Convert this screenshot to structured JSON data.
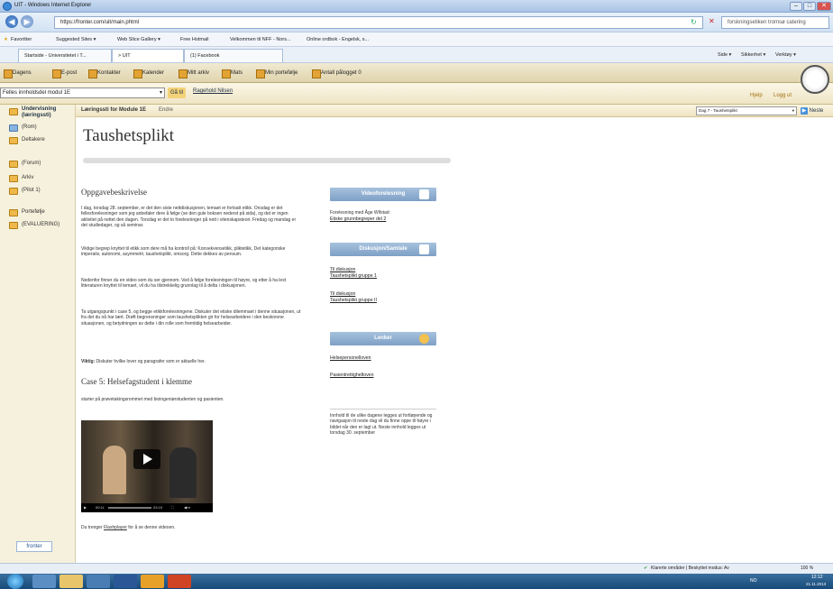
{
  "window": {
    "title": "UIT - Windows Internet Explorer"
  },
  "address": {
    "url": "https://fronter.com/uit/main.phtml",
    "search_placeholder": "forskningsetiken tromsø catering"
  },
  "favorites": {
    "label": "Favoritter",
    "items": [
      "Suggested Sites ▾",
      "Web Slice Gallery ▾",
      "Free Hotmail",
      "Velkommen til NFF - Nors...",
      "Online ordbok - Engelsk, s..."
    ]
  },
  "tabs": [
    {
      "label": "Startside - Universitetet i T..."
    },
    {
      "label": "> UIT"
    },
    {
      "label": "(1) Facebook"
    }
  ],
  "ie_commands": {
    "side": "Side ▾",
    "sikkerhet": "Sikkerhet ▾",
    "verktoy": "Verktøy ▾"
  },
  "lms_nav": [
    "Dagens",
    "E-post",
    "Kontakter",
    "Kalender",
    "Mitt arkiv",
    "Mats",
    "Min portefølje",
    "Antall pålogget 0"
  ],
  "module": {
    "select_value": "Felles innholdsdel modul 1E",
    "go_label": "Gå til",
    "table_link": "Ragehold Nilsen",
    "help": "Hjelp",
    "logout": "Logg ut"
  },
  "sidebar": {
    "items": [
      "Undervisning (læringssti)",
      "(Rom)",
      "Deltakere",
      "(Forum)",
      "Arkiv",
      "(Pilot 1)",
      "Portefølje",
      "(EVALUERING)"
    ],
    "footer_logo": "fronter"
  },
  "crumb": {
    "path": "Læringssti for Module 1E",
    "edit": "Endre",
    "day_select": "Dag 7 - Taushetsplikt",
    "next": "Neste"
  },
  "page": {
    "title": "Taushetsplikt",
    "overview_heading": "Oppgavebeskrivelse",
    "paragraphs": [
      "I dag, torsdag 28. september, er det den siste nettdiskusjonen, temaet er fortsatt etikk. Onsdag er det fellesforelesninger som jeg anbefaler dere å følge (se den gule boksen nederst på sida), og det er ingen aktivitet på nettet den dagen. Torsdag er det to forelesninger på nett i vitenskapsteori. Fredag og mandag er det studiedager, og så seminar.",
      "Viktige begrep knyttet til etikk som dere må ha kontroll på: Konsekvensetikk, pliktetikk, Det kategoriske imperativ, autonomi, asymmetri, taushetsplikt, omsorg. Dette dekkes av pensum.",
      "Nedenfor finner du en video som du ser gjennom. Ved å følge forelesningen til høyre, og etter å ha lest litteraturen knyttet til temaet, vil du ha tilstrekkelig grunnlag til å delta i diskusjonen.",
      "Ta utgangspunkt i case 5, og begge etikkforelesningene. Diskuter det etiske dilemmaet i denne situasjonen, ut fra det du nå har lært. Drøft begrensninger som taushetsplikten gir for helsearbeidere i den beskrevne situasjonen, og betydningen av dette i din rolle som fremtidig helsearbeider."
    ],
    "important_label": "Viktig:",
    "important_text": " Diskuter hvilke lover og paragrafer som er aktuelle her.",
    "case_heading": "Case 5: Helsefagstudent i klemme",
    "case_text": "starter på prøvetakingsrommet med bioingeniørstudenten og pasienten.",
    "video_time_start": "00:11",
    "video_time_end": "03:15",
    "flash_pre": "Du trenger ",
    "flash_link": "Flashplayer",
    "flash_post": " for å se denne videoen."
  },
  "side_sections": {
    "video": {
      "title": "Videoforelesning",
      "text": "Forelesning med Åge Wifstad:",
      "link": "Etiske grunnbegreper del 2"
    },
    "discussion": {
      "title": "Diskusjon/Samtale",
      "links": [
        [
          "Til diskusjon",
          "Taushetsplikt gruppe 1"
        ],
        [
          "Til diskusjon",
          "Taushetsplikt gruppe II"
        ]
      ]
    },
    "links": {
      "title": "Lenker",
      "items": [
        "Helsepersonelloven",
        "Pasientrettighetloven"
      ]
    },
    "note": "Innhold til de ulike dagene legges ut fortløpende og navigasjon til neste dag vil du finne oppe til høyre i bildet når den er lagt ut. Neste innhold legges ut torsdag 30. september"
  },
  "status": {
    "zone": "Klarerte områder | Beskyttet modus: Av",
    "zoom": "100 %"
  },
  "taskbar": {
    "lang": "NO",
    "time": "12:12",
    "date": "21.11.2013"
  }
}
